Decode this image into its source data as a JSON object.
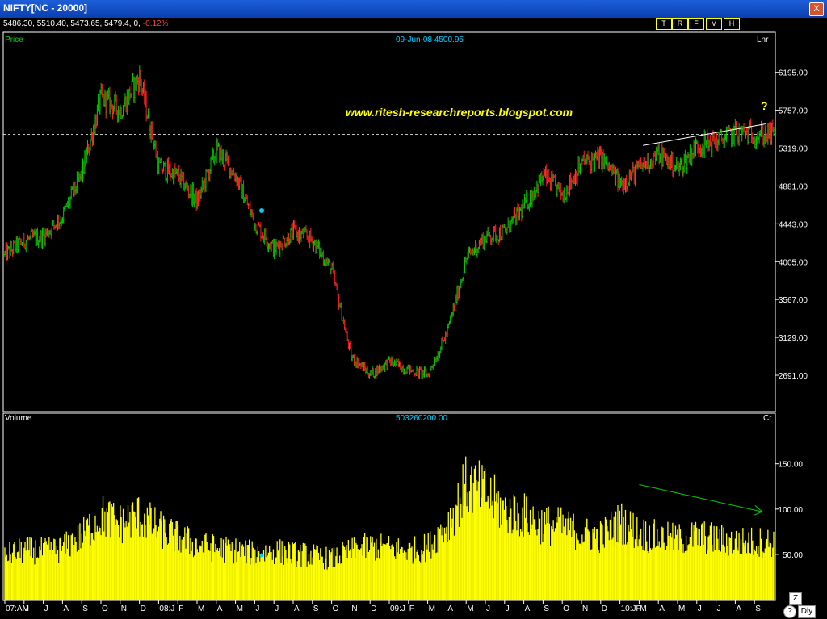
{
  "window": {
    "title": "NIFTY[NC - 20000]",
    "close_label": "X"
  },
  "quote": {
    "prices": "5486.30, 5510.40, 5473.65, 5479.4,",
    "zero": "0,",
    "change": "-0.12%"
  },
  "toolbar": {
    "buttons": [
      "T",
      "R",
      "F",
      "V",
      "H"
    ]
  },
  "price_panel": {
    "label": "Price",
    "date_readout": "09-Jun-08 4500.95",
    "scale_label": "Lnr"
  },
  "volume_panel": {
    "label": "Volume",
    "value_readout": "503260200.00",
    "unit_label": "Cr"
  },
  "watermark": "www.ritesh-researchreports.blogspot.com",
  "question_mark": "?",
  "bottom_controls": {
    "zoom_label": "Z",
    "help_label": "?",
    "period_label": "Dly"
  },
  "colors": {
    "up": "#00cc00",
    "down": "#ff2020",
    "volume": "#ffff00",
    "grid": "#ffffff",
    "trendline": "#ffffff",
    "arrow": "#00cc00",
    "accent": "#00ccff"
  },
  "chart_data": [
    {
      "type": "ohlc",
      "title": "Price",
      "y_ticks": [
        6195.0,
        5757.0,
        5319.0,
        4881.0,
        4443.0,
        4005.0,
        3567.0,
        3129.0,
        2691.0
      ],
      "ylim": [
        2280,
        6650
      ],
      "dashed_reference": 5479.4,
      "x_tick_labels": [
        "07:AM",
        "J",
        "J",
        "A",
        "S",
        "O",
        "N",
        "D",
        "08:J",
        "F",
        "M",
        "A",
        "M",
        "J",
        "J",
        "A",
        "S",
        "O",
        "N",
        "D",
        "09:J",
        "F",
        "M",
        "A",
        "M",
        "J",
        "J",
        "A",
        "S",
        "O",
        "N",
        "D",
        "10:JF",
        "M",
        "A",
        "M",
        "J",
        "J",
        "A",
        "S"
      ],
      "monthly_closes": [
        4087,
        4250,
        4300,
        4530,
        5020,
        5900,
        5760,
        6140,
        5100,
        5000,
        4700,
        5300,
        5000,
        4450,
        4150,
        4350,
        4250,
        3900,
        2900,
        2700,
        2850,
        2750,
        2700,
        3200,
        4050,
        4300,
        4350,
        4650,
        5000,
        4780,
        5150,
        5200,
        4900,
        5100,
        5250,
        5080,
        5350,
        5400,
        5500,
        5479
      ]
    },
    {
      "type": "bar",
      "title": "Volume",
      "y_ticks": [
        150.0,
        100.0,
        50.0
      ],
      "ylim": [
        0,
        205
      ],
      "monthly_volume": [
        50,
        56,
        55,
        58,
        72,
        95,
        86,
        95,
        80,
        70,
        62,
        58,
        56,
        52,
        55,
        52,
        50,
        46,
        55,
        60,
        58,
        55,
        60,
        85,
        130,
        120,
        100,
        95,
        85,
        82,
        75,
        72,
        88,
        75,
        70,
        68,
        72,
        68,
        65,
        65
      ]
    }
  ]
}
